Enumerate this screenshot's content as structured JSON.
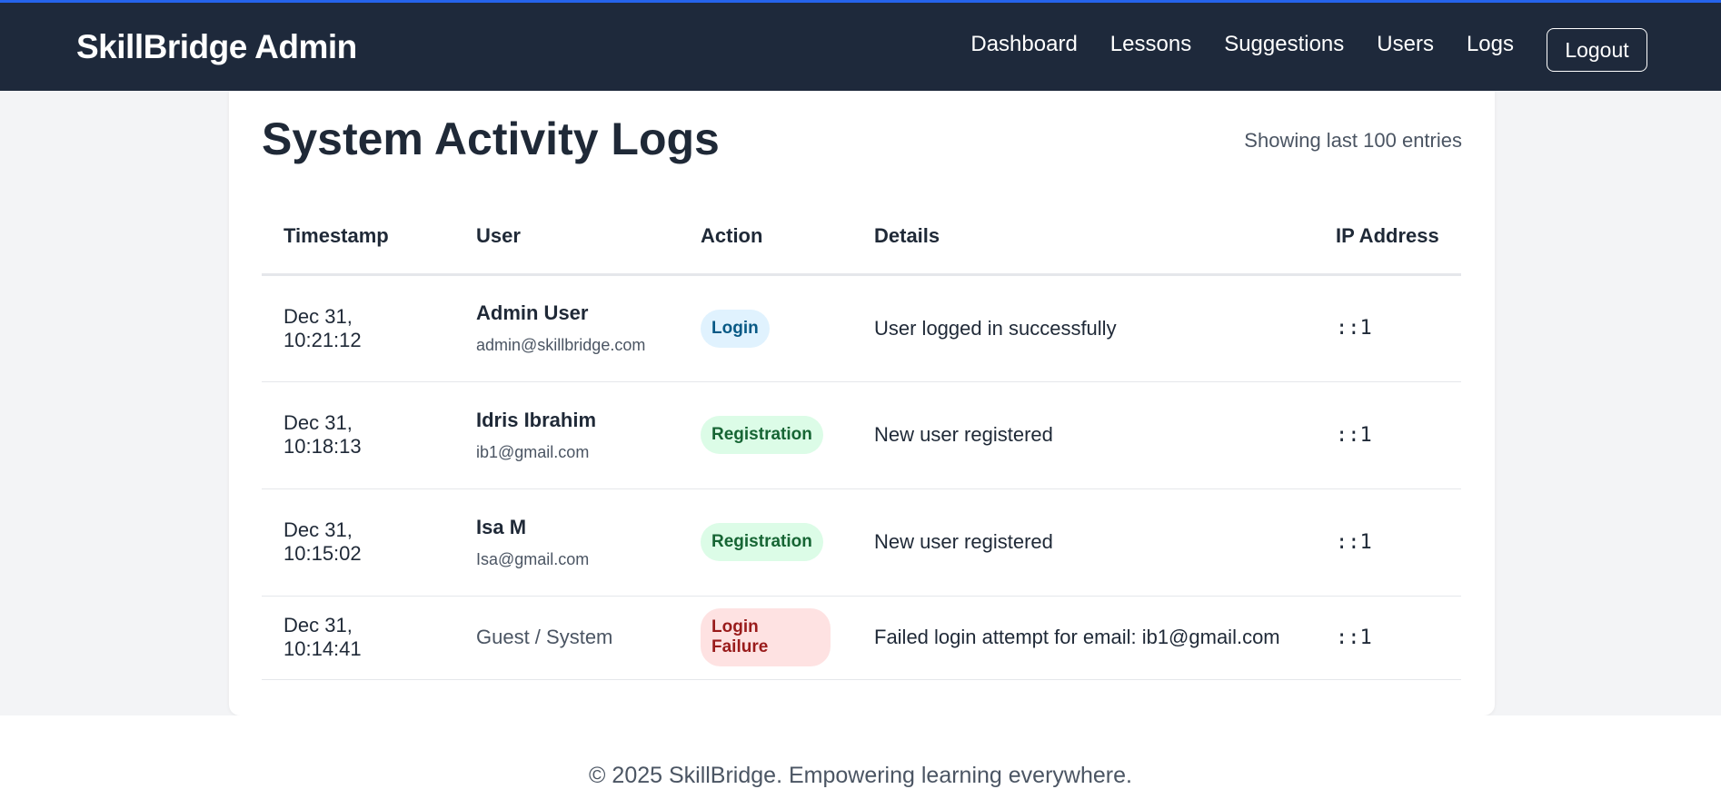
{
  "header": {
    "brand": "SkillBridge Admin",
    "nav": [
      "Dashboard",
      "Lessons",
      "Suggestions",
      "Users",
      "Logs"
    ],
    "logout_label": "Logout"
  },
  "page": {
    "title": "System Activity Logs",
    "entries_note": "Showing last 100 entries"
  },
  "table": {
    "columns": [
      "Timestamp",
      "User",
      "Action",
      "Details",
      "IP Address"
    ],
    "rows": [
      {
        "timestamp": "Dec 31, 10:21:12",
        "user_name": "Admin User",
        "user_email": "admin@skillbridge.com",
        "action": "Login",
        "details": "User logged in successfully",
        "ip": "::1"
      },
      {
        "timestamp": "Dec 31, 10:18:13",
        "user_name": "Idris Ibrahim",
        "user_email": "ib1@gmail.com",
        "action": "Registration",
        "details": "New user registered",
        "ip": "::1"
      },
      {
        "timestamp": "Dec 31, 10:15:02",
        "user_name": "Isa M",
        "user_email": "Isa@gmail.com",
        "action": "Registration",
        "details": "New user registered",
        "ip": "::1"
      },
      {
        "timestamp": "Dec 31, 10:14:41",
        "user_guest": "Guest / System",
        "action": "Login Failure",
        "details": "Failed login attempt for email: ib1@gmail.com",
        "ip": "::1"
      }
    ]
  },
  "footer": {
    "text": "© 2025 SkillBridge. Empowering learning everywhere."
  },
  "colors": {
    "header_bg": "#1e293b",
    "accent": "#2563eb",
    "login_badge_bg": "#e0f2fe",
    "registration_badge_bg": "#dcfce7",
    "failure_badge_bg": "#fee2e2"
  }
}
